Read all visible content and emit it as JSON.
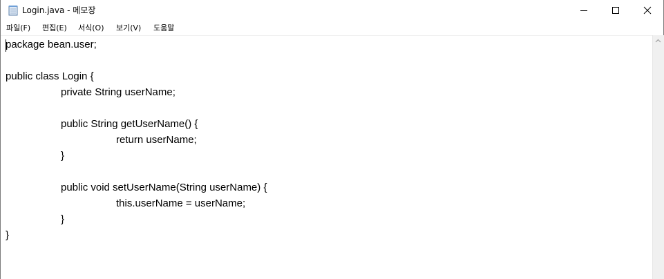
{
  "window": {
    "title": "Login.java - 메모장",
    "minimize_icon": "minimize-icon",
    "maximize_icon": "maximize-icon",
    "close_icon": "close-icon"
  },
  "menu": {
    "items": [
      {
        "label": "파일(F)"
      },
      {
        "label": "편집(E)"
      },
      {
        "label": "서식(O)"
      },
      {
        "label": "보기(V)"
      },
      {
        "label": "도움말"
      }
    ]
  },
  "editor": {
    "lines": [
      "package bean.user;",
      "",
      "public class Login {",
      "\t\tprivate String userName;",
      "",
      "\t\tpublic String getUserName() {",
      "\t\t\t\treturn userName;",
      "\t\t}",
      "",
      "\t\tpublic void setUserName(String userName) {",
      "\t\t\t\tthis.userName = userName;",
      "\t\t}",
      "}"
    ]
  },
  "colors": {
    "background": "#ffffff",
    "text": "#000000",
    "scrollbar": "#f0f0f0"
  }
}
